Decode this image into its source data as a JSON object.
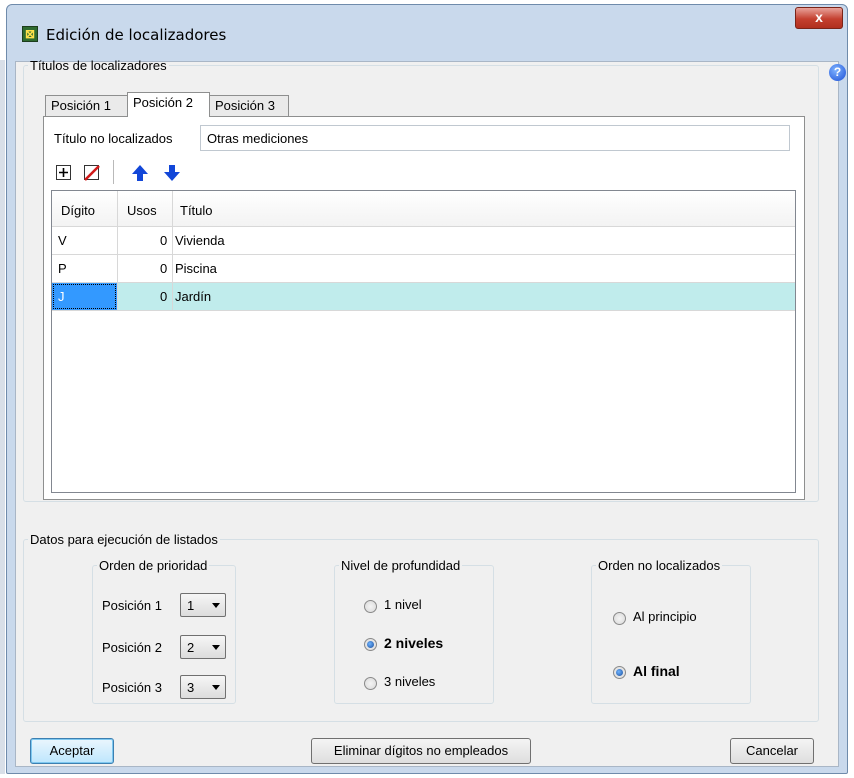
{
  "window": {
    "title": "Edición de localizadores",
    "close_label": "x",
    "help_label": "?"
  },
  "locators_group": {
    "title": "Títulos de localizadores",
    "tabs": [
      {
        "label": "Posición 1",
        "active": false
      },
      {
        "label": "Posición 2",
        "active": true
      },
      {
        "label": "Posición 3",
        "active": false
      }
    ],
    "not_located_label": "Título no localizados",
    "not_located_value": "Otras mediciones",
    "toolbar": [
      "add-row-icon",
      "delete-row-icon",
      "move-up-icon",
      "move-down-icon"
    ],
    "table": {
      "columns": [
        "Dígito",
        "Usos",
        "Título"
      ],
      "rows": [
        {
          "digit": "V",
          "uses": "0",
          "title": "Vivienda",
          "selected": false
        },
        {
          "digit": "P",
          "uses": "0",
          "title": "Piscina",
          "selected": false
        },
        {
          "digit": "J",
          "uses": "0",
          "title": "Jardín",
          "selected": true
        }
      ]
    }
  },
  "listing_group": {
    "title": "Datos para ejecución de listados",
    "priority": {
      "title": "Orden de prioridad",
      "items": [
        {
          "label": "Posición 1",
          "value": "1"
        },
        {
          "label": "Posición 2",
          "value": "2"
        },
        {
          "label": "Posición 3",
          "value": "3"
        }
      ]
    },
    "depth": {
      "title": "Nivel de profundidad",
      "options": [
        {
          "label": "1 nivel",
          "selected": false
        },
        {
          "label": "2 niveles",
          "selected": true
        },
        {
          "label": "3 niveles",
          "selected": false
        }
      ]
    },
    "unlocated_order": {
      "title": "Orden no localizados",
      "options": [
        {
          "label": "Al principio",
          "selected": false
        },
        {
          "label": "Al final",
          "selected": true
        }
      ]
    }
  },
  "buttons": {
    "accept": "Aceptar",
    "remove_unused": "Eliminar dígitos no empleados",
    "cancel": "Cancelar"
  },
  "colors": {
    "selection_row": "#c0ecec",
    "selection_cell": "#3399ff",
    "arrow_blue": "#1246d8",
    "delete_red": "#d11a1a"
  }
}
